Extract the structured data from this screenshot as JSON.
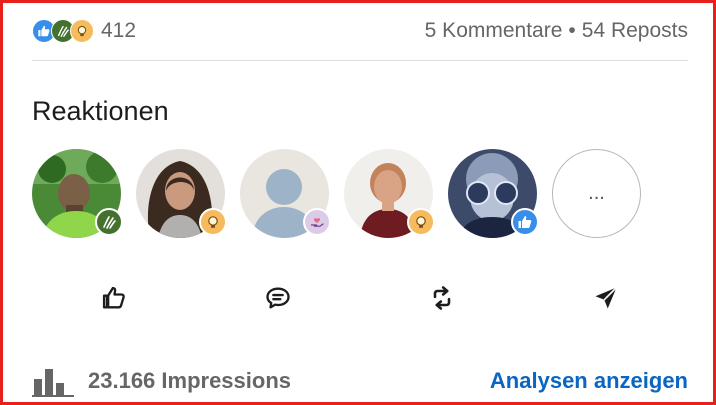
{
  "social": {
    "reaction_icons": [
      "like",
      "celebrate",
      "insight"
    ],
    "reaction_count": "412",
    "comments": "5 Kommentare",
    "separator": "•",
    "reposts": "54 Reposts"
  },
  "reactions_section": {
    "title": "Reaktionen",
    "avatars": [
      {
        "name": "user-avatar-1",
        "reaction": "celebrate"
      },
      {
        "name": "user-avatar-2",
        "reaction": "insight"
      },
      {
        "name": "user-avatar-3",
        "reaction": "support"
      },
      {
        "name": "user-avatar-4",
        "reaction": "insight"
      },
      {
        "name": "user-avatar-5",
        "reaction": "like"
      }
    ],
    "more_label": "..."
  },
  "actions": [
    "like-icon",
    "comment-icon",
    "repost-icon",
    "send-icon"
  ],
  "footer": {
    "impressions": "23.166 Impressions",
    "analytics_link": "Analysen anzeigen"
  },
  "colors": {
    "link": "#0a66c2",
    "like": "#378fe9",
    "celebrate": "#44712e",
    "insight": "#f5bb5c",
    "frame": "#e8201c"
  }
}
